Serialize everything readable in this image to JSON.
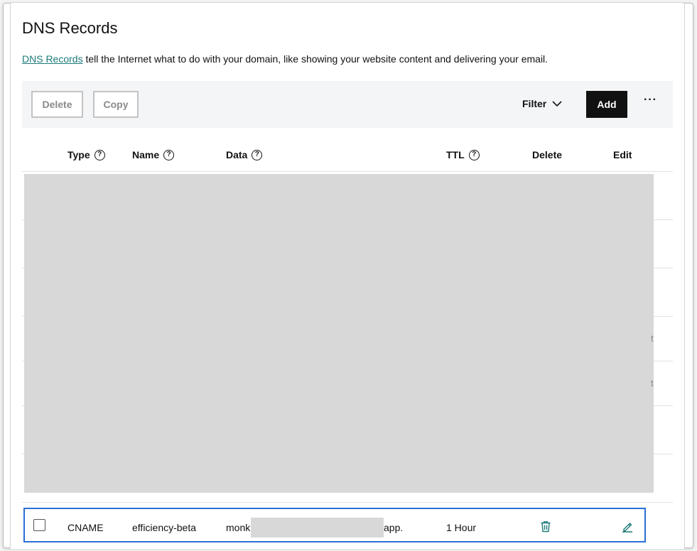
{
  "page": {
    "title": "DNS Records",
    "intro_link": "DNS Records",
    "intro_text": " tell the Internet what to do with your domain, like showing your website content and delivering your email."
  },
  "toolbar": {
    "delete_label": "Delete",
    "copy_label": "Copy",
    "filter_label": "Filter",
    "add_label": "Add",
    "more_label": "···"
  },
  "table": {
    "headers": {
      "type": "Type",
      "name": "Name",
      "data": "Data",
      "ttl": "TTL",
      "delete": "Delete",
      "edit": "Edit"
    },
    "help_glyph": "?",
    "edge_fragments": [
      "t",
      "t"
    ],
    "selected_row": {
      "type": "CNAME",
      "name": "efficiency-beta",
      "data_prefix": "monk",
      "data_suffix": "app.",
      "ttl": "1 Hour"
    }
  },
  "colors": {
    "accent": "#1b7a79",
    "selection": "#2b6fd6",
    "primary_button": "#111111",
    "redaction": "#d8d8d8"
  },
  "icons": {
    "filter": "chevron-down-icon",
    "delete": "trash-icon",
    "edit": "pencil-icon",
    "help": "help-circle-icon"
  }
}
